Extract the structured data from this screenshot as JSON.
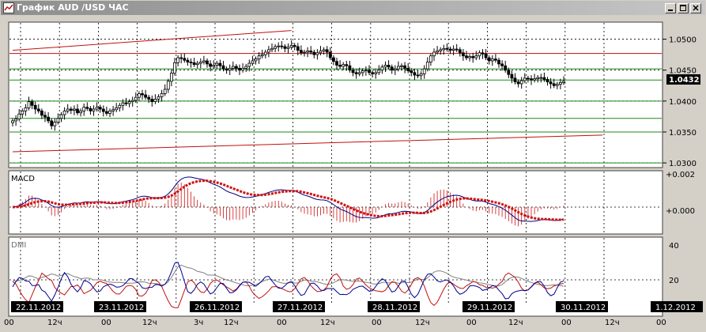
{
  "window": {
    "title": "График AUD /USD  ЧАС",
    "buttons": [
      "minimize",
      "maximize",
      "close"
    ]
  },
  "chart_data": {
    "type": "candlestick",
    "title": "График AUD /USD  ЧАС",
    "symbol": "AUD/USD",
    "timeframe": "ЧАС",
    "current_price": "1.0432",
    "price_ticks": [
      "1.0500",
      "1.0450",
      "1.0400",
      "1.0350",
      "1.0300"
    ],
    "ylim": [
      1.0295,
      1.0525
    ],
    "date_labels": [
      "22.11.2012",
      "23.11.2012",
      "26.11.2012",
      "27.11.2012",
      "28.11.2012",
      "29.11.2012",
      "30.11.2012",
      "1.12.2012"
    ],
    "time_labels": [
      "00",
      "12ч",
      "00",
      "12ч",
      "3ч",
      "12ч",
      "00",
      "12ч",
      "00",
      "12ч",
      "00",
      "12ч",
      "00",
      "12ч",
      "00"
    ],
    "horizontal_levels": [
      {
        "price": 1.0477,
        "color": "#c01010"
      },
      {
        "price": 1.0452,
        "color": "#1a8a1a"
      },
      {
        "price": 1.0434,
        "color": "#1a8a1a"
      },
      {
        "price": 1.04,
        "color": "#1a8a1a"
      },
      {
        "price": 1.0372,
        "color": "#1a8a1a"
      },
      {
        "price": 1.035,
        "color": "#1a8a1a"
      },
      {
        "price": 1.03,
        "color": "#1a8a1a"
      }
    ],
    "trend_lines": [
      {
        "color": "#c01010",
        "from": {
          "bar": 0,
          "price": 1.0482
        },
        "to": {
          "bar": 86,
          "price": 1.0514
        }
      },
      {
        "color": "#c01010",
        "from": {
          "bar": 0,
          "price": 1.0318
        },
        "to": {
          "bar": 182,
          "price": 1.0345
        }
      }
    ],
    "candles_close": [
      1.0368,
      1.0371,
      1.0379,
      1.0384,
      1.0389,
      1.0399,
      1.0393,
      1.0387,
      1.0384,
      1.0377,
      1.0374,
      1.0368,
      1.036,
      1.0366,
      1.0372,
      1.0378,
      1.0384,
      1.0387,
      1.0385,
      1.0387,
      1.0381,
      1.0384,
      1.039,
      1.0388,
      1.0384,
      1.0387,
      1.039,
      1.0387,
      1.0383,
      1.038,
      1.0384,
      1.0386,
      1.0389,
      1.0393,
      1.0397,
      1.0396,
      1.0399,
      1.0401,
      1.0406,
      1.0412,
      1.041,
      1.0406,
      1.0403,
      1.0399,
      1.0403,
      1.0407,
      1.0412,
      1.0419,
      1.0432,
      1.0445,
      1.0462,
      1.047,
      1.0469,
      1.0466,
      1.0463,
      1.0462,
      1.0459,
      1.0461,
      1.0463,
      1.0465,
      1.046,
      1.0456,
      1.0458,
      1.0461,
      1.0457,
      1.0452,
      1.045,
      1.0453,
      1.0456,
      1.0453,
      1.045,
      1.0453,
      1.0456,
      1.0461,
      1.0465,
      1.0468,
      1.0473,
      1.0475,
      1.0479,
      1.0483,
      1.0485,
      1.0488,
      1.0489,
      1.0488,
      1.0485,
      1.0487,
      1.049,
      1.0488,
      1.0482,
      1.0478,
      1.0479,
      1.0481,
      1.0479,
      1.0475,
      1.0478,
      1.0481,
      1.0483,
      1.0479,
      1.047,
      1.0464,
      1.0458,
      1.0456,
      1.0459,
      1.0457,
      1.045,
      1.0446,
      1.0444,
      1.0446,
      1.0449,
      1.045,
      1.0446,
      1.0444,
      1.0446,
      1.045,
      1.0455,
      1.0458,
      1.0455,
      1.045,
      1.0452,
      1.0456,
      1.0457,
      1.0453,
      1.0449,
      1.0446,
      1.0442,
      1.0441,
      1.0444,
      1.0452,
      1.0463,
      1.0473,
      1.0479,
      1.0481,
      1.0483,
      1.0485,
      1.0484,
      1.0482,
      1.0484,
      1.0483,
      1.0478,
      1.0473,
      1.047,
      1.0472,
      1.047,
      1.0473,
      1.0478,
      1.0476,
      1.047,
      1.0465,
      1.0468,
      1.0466,
      1.046,
      1.0457,
      1.045,
      1.0443,
      1.0437,
      1.0431,
      1.0428,
      1.0433,
      1.0437,
      1.0436,
      1.0434,
      1.0436,
      1.0438,
      1.0438,
      1.0435,
      1.0431,
      1.0428,
      1.0425,
      1.0427,
      1.043,
      1.0432
    ],
    "macd": {
      "label": "MACD",
      "ticks": [
        "+0.002",
        "+0.000"
      ],
      "main_color": "#000080",
      "signal_color": "#d01010"
    },
    "dmi": {
      "label": "DMI",
      "ticks": [
        "40",
        "20"
      ],
      "series_colors": [
        "#808080",
        "#c01010",
        "#000090"
      ]
    },
    "session_lines_at_bars": [
      0,
      12,
      24,
      36,
      48,
      60,
      72,
      84,
      96,
      108,
      120,
      132,
      144,
      156,
      168,
      180
    ]
  }
}
